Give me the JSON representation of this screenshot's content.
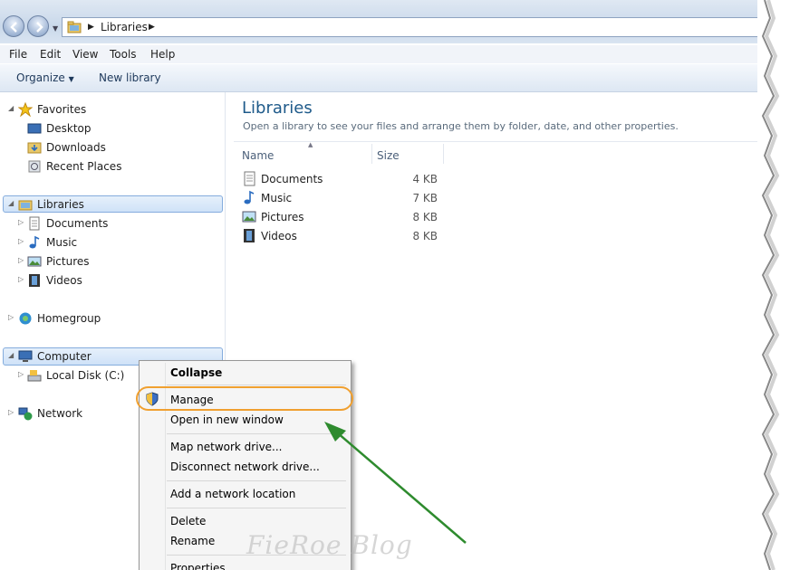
{
  "address_bar": {
    "crumbs": [
      "Libraries"
    ]
  },
  "menu_bar": [
    "File",
    "Edit",
    "View",
    "Tools",
    "Help"
  ],
  "toolbar": {
    "organize_label": "Organize",
    "new_library_label": "New library"
  },
  "nav_pane": {
    "favorites": {
      "label": "Favorites",
      "items": [
        "Desktop",
        "Downloads",
        "Recent Places"
      ]
    },
    "libraries": {
      "label": "Libraries",
      "items": [
        "Documents",
        "Music",
        "Pictures",
        "Videos"
      ]
    },
    "homegroup": {
      "label": "Homegroup"
    },
    "computer": {
      "label": "Computer",
      "items": [
        "Local Disk (C:)"
      ]
    },
    "network": {
      "label": "Network"
    }
  },
  "content": {
    "title": "Libraries",
    "subtitle": "Open a library to see your files and arrange them by folder, date, and other properties.",
    "columns": {
      "name": "Name",
      "size": "Size"
    },
    "files": [
      {
        "name": "Documents",
        "size": "4 KB",
        "icon": "documents-library-icon"
      },
      {
        "name": "Music",
        "size": "7 KB",
        "icon": "music-library-icon"
      },
      {
        "name": "Pictures",
        "size": "8 KB",
        "icon": "pictures-library-icon"
      },
      {
        "name": "Videos",
        "size": "8 KB",
        "icon": "videos-library-icon"
      }
    ]
  },
  "context_menu": {
    "collapse": "Collapse",
    "manage": "Manage",
    "open_new_window": "Open in new window",
    "map_drive": "Map network drive...",
    "disconnect_drive": "Disconnect network drive...",
    "add_location": "Add a network location",
    "delete": "Delete",
    "rename": "Rename",
    "properties": "Properties"
  },
  "annotation": {
    "highlight_color": "#f0a030",
    "arrow_color": "#2e8b2e"
  },
  "watermark": "FieRoe Blog"
}
